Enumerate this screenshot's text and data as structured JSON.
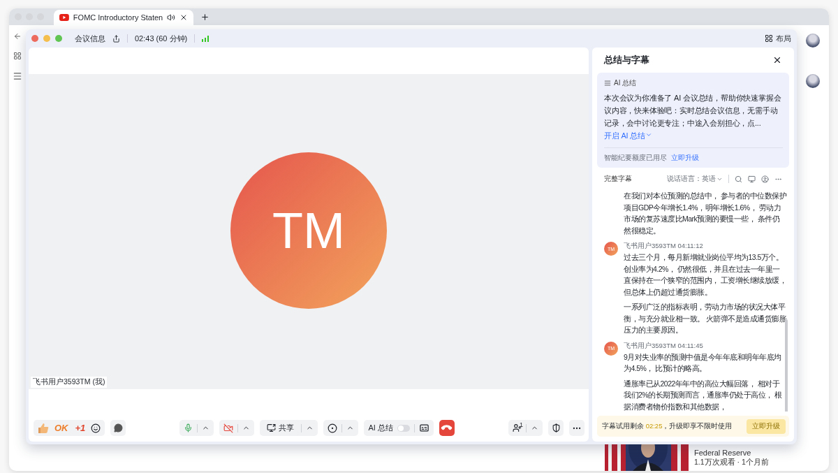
{
  "browser": {
    "tab_title": "FOMC Introductory Staten"
  },
  "video_page": {
    "channel": "Federal Reserve",
    "views": "1.1万次观看 · 1个月前"
  },
  "meeting": {
    "title_bar": {
      "info": "会议信息",
      "timer": "02:43 (60 分钟)",
      "layout": "布局"
    },
    "stage": {
      "initials": "TM",
      "name_label": "飞书用户3593TM (我)"
    },
    "toolbar": {
      "reactions": [
        "OK",
        "+1"
      ],
      "share": "共享",
      "ai_summary": {
        "label": "AI 总结",
        "on": false
      },
      "participants": "1"
    }
  },
  "panel": {
    "title": "总结与字幕",
    "ai_card": {
      "heading": "AI 总结",
      "body": "本次会议为你准备了 AI 会议总结，帮助你快速掌握会议内容，快来体验吧：实时总结会议信息，无需手动记录，会中讨论更专注；中途入会别担心，点...",
      "link": "开启 AI 总结",
      "quota": "智能纪要额度已用尽",
      "upgrade": "立即升级"
    },
    "transcript": {
      "label": "完整字幕",
      "language": "说话语言：英语",
      "entries": [
        {
          "kind": "continuation",
          "paragraphs": [
            [
              "在我们对本位预测的总结中， 参与者的中位数保护",
              "项目GDP今年增长1.4%，明年增长1.6%， 劳动力",
              "市场的复苏速度比Mark预测的要慢一些， 条件仍",
              "然很稳定。"
            ]
          ]
        },
        {
          "kind": "speaker",
          "initials": "TM",
          "speaker": "飞书用户3593TM",
          "time": "04:11:12",
          "paragraphs": [
            [
              "过去三个月，每月新增就业岗位平均为13.5万个。",
              "创业率为4.2%， 仍然很低，并且在过去一年里一",
              "直保持在一个狭窄的范围内， 工资增长继续放缓，",
              "但总体上仍超过通货膨胀。"
            ],
            [
              "一系列广泛的指标表明，劳动力市场的状况大体平",
              "衡，与充分就业相一致。 火箭弹不是造成通货膨胀",
              "压力的主要原因。"
            ]
          ]
        },
        {
          "kind": "speaker",
          "initials": "TM",
          "speaker": "飞书用户3593TM",
          "time": "04:11:45",
          "paragraphs": [
            [
              "9月对失业率的预测中值是今年年底和明年年底均",
              "为4.5%， 比预计的略高。"
            ],
            [
              "通胀率已从2022年年中的高位大幅回落， 相对于",
              "我们2%的长期预测而言，通胀率仍处于高位， 根",
              "据消费者物价指数和其他数据，"
            ]
          ]
        }
      ]
    },
    "banner": {
      "before": "字幕试用剩余 ",
      "remaining": "02:25",
      "after": "，升级即享不限时使用",
      "button": "立即升级"
    }
  }
}
